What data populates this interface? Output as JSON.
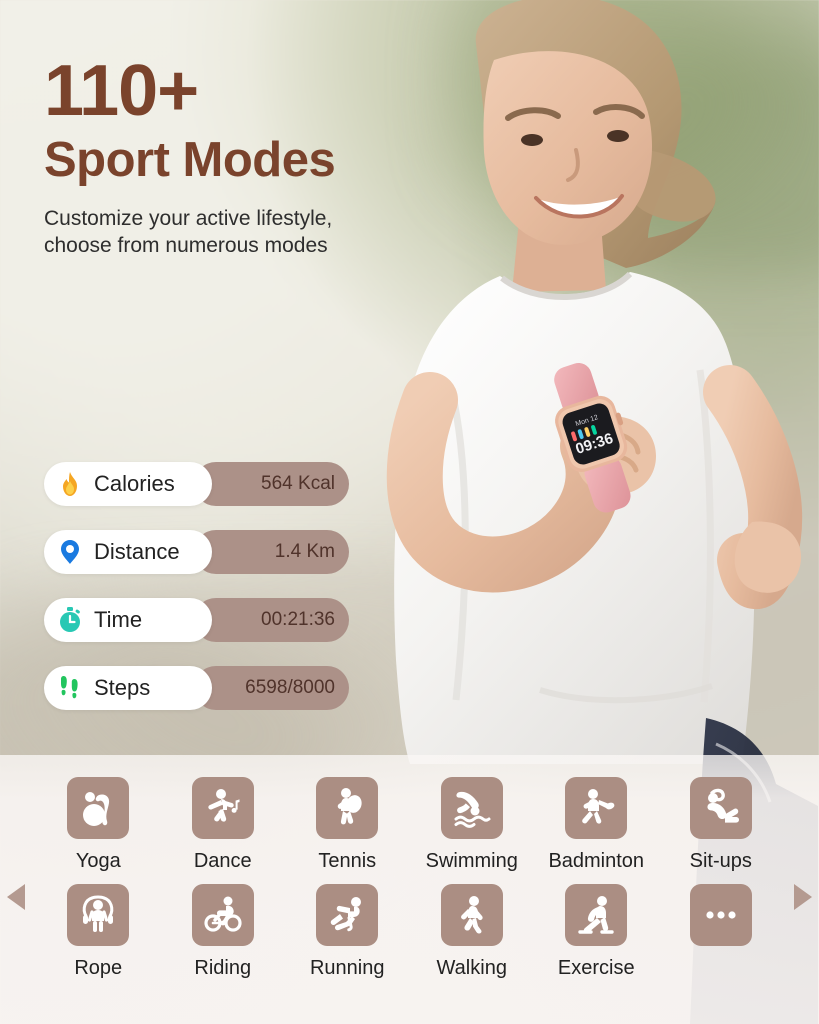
{
  "headline": {
    "count": "110+",
    "title": "Sport Modes",
    "description": "Customize your active lifestyle,\nchoose from numerous modes"
  },
  "colors": {
    "heading_brown": "#7a432c",
    "tile_taupe": "#ab8e83",
    "pill_value_bg": "#ac9188",
    "pill_label_bg": "#ffffff",
    "body_text": "#2e2e2e",
    "arrow": "#b49a90",
    "flame_orange": "#f5a623",
    "pin_blue": "#1a7ae0",
    "stopwatch_teal": "#28c8b4",
    "footsteps_green": "#22c55e"
  },
  "stats": [
    {
      "icon": "flame-icon",
      "label": "Calories",
      "value": "564 Kcal"
    },
    {
      "icon": "location-pin-icon",
      "label": "Distance",
      "value": "1.4 Km"
    },
    {
      "icon": "stopwatch-icon",
      "label": "Time",
      "value": "00:21:36"
    },
    {
      "icon": "footsteps-icon",
      "label": "Steps",
      "value": "6598/8000"
    }
  ],
  "modes": [
    {
      "icon": "yoga-icon",
      "label": "Yoga"
    },
    {
      "icon": "dance-icon",
      "label": "Dance"
    },
    {
      "icon": "tennis-icon",
      "label": "Tennis"
    },
    {
      "icon": "swimming-icon",
      "label": "Swimming"
    },
    {
      "icon": "badminton-icon",
      "label": "Badminton"
    },
    {
      "icon": "situps-icon",
      "label": "Sit-ups"
    },
    {
      "icon": "jumprope-icon",
      "label": "Rope"
    },
    {
      "icon": "cycling-icon",
      "label": "Riding"
    },
    {
      "icon": "running-icon",
      "label": "Running"
    },
    {
      "icon": "walking-icon",
      "label": "Walking"
    },
    {
      "icon": "stretching-icon",
      "label": "Exercise"
    },
    {
      "icon": "more-ellipsis-icon",
      "label": ""
    }
  ],
  "carousel": {
    "prev_icon": "triangle-left-icon",
    "next_icon": "triangle-right-icon"
  },
  "product": {
    "device": "smartwatch",
    "band_color": "pink",
    "case_color": "rose-gold"
  }
}
